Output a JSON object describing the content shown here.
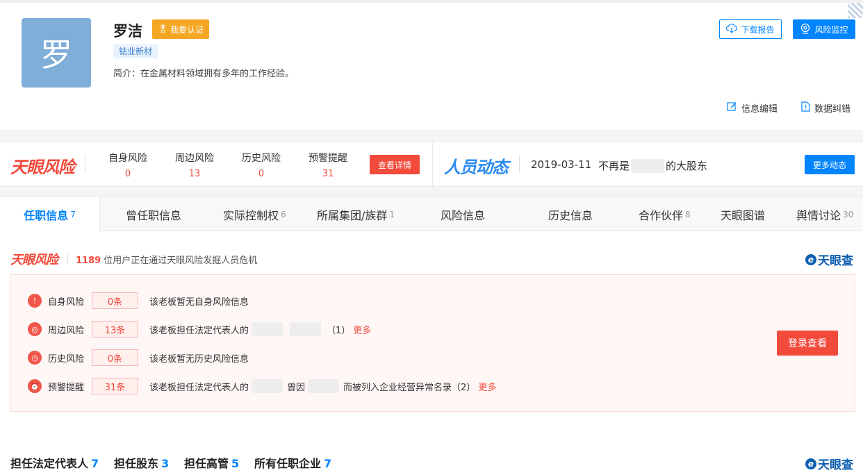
{
  "profile": {
    "avatar_char": "罗",
    "name": "罗洁",
    "cert_label": "我要认证",
    "tag": "钴业新材",
    "intro": "简介：在金属材料领域拥有多年的工作经验。",
    "download_label": "下载报告",
    "monitor_label": "风险监控",
    "edit_label": "信息编辑",
    "fix_label": "数据纠错"
  },
  "risk_summary": {
    "logo": "天眼风险",
    "items": [
      {
        "label": "自身风险",
        "value": "0"
      },
      {
        "label": "周边风险",
        "value": "13"
      },
      {
        "label": "历史风险",
        "value": "0"
      },
      {
        "label": "预警提醒",
        "value": "31"
      }
    ],
    "detail_label": "查看详情"
  },
  "dynamics": {
    "logo": "人员动态",
    "date": "2019-03-11",
    "text_before": "不再是",
    "text_after": "的大股东",
    "more_label": "更多动态"
  },
  "tabs": [
    {
      "label": "任职信息",
      "count": "7",
      "active": true
    },
    {
      "label": "曾任职信息",
      "count": ""
    },
    {
      "label": "实际控制权",
      "count": "6"
    },
    {
      "label": "所属集团/族群",
      "count": "1"
    },
    {
      "label": "风险信息",
      "count": ""
    },
    {
      "label": "历史信息",
      "count": ""
    },
    {
      "label": "合作伙伴",
      "count": "8"
    },
    {
      "label": "天眼图谱",
      "count": ""
    },
    {
      "label": "舆情讨论",
      "count": "30"
    }
  ],
  "risk_section": {
    "logo": "天眼风险",
    "user_count": "1189",
    "user_text": "位用户正在通过天眼风险发掘人员危机",
    "brand": "天眼查",
    "rows": [
      {
        "label": "自身风险",
        "count": "0条",
        "text": "该老板暂无自身风险信息"
      },
      {
        "label": "周边风险",
        "count": "13条",
        "text_a": "该老板担任法定代表人的",
        "text_b": "（1）",
        "more": "更多"
      },
      {
        "label": "历史风险",
        "count": "0条",
        "text": "该老板暂无历史风险信息"
      },
      {
        "label": "预警提醒",
        "count": "31条",
        "text_a": "该老板担任法定代表人的",
        "text_mid": "曾因",
        "text_b": "而被列入企业经营异常名录（2）",
        "more": "更多"
      }
    ],
    "login_label": "登录查看"
  },
  "bottom_tabs": [
    {
      "label": "担任法定代表人",
      "count": "7"
    },
    {
      "label": "担任股东",
      "count": "3"
    },
    {
      "label": "担任高管",
      "count": "5"
    },
    {
      "label": "所有任职企业",
      "count": "7"
    }
  ],
  "bottom_brand": "天眼查"
}
